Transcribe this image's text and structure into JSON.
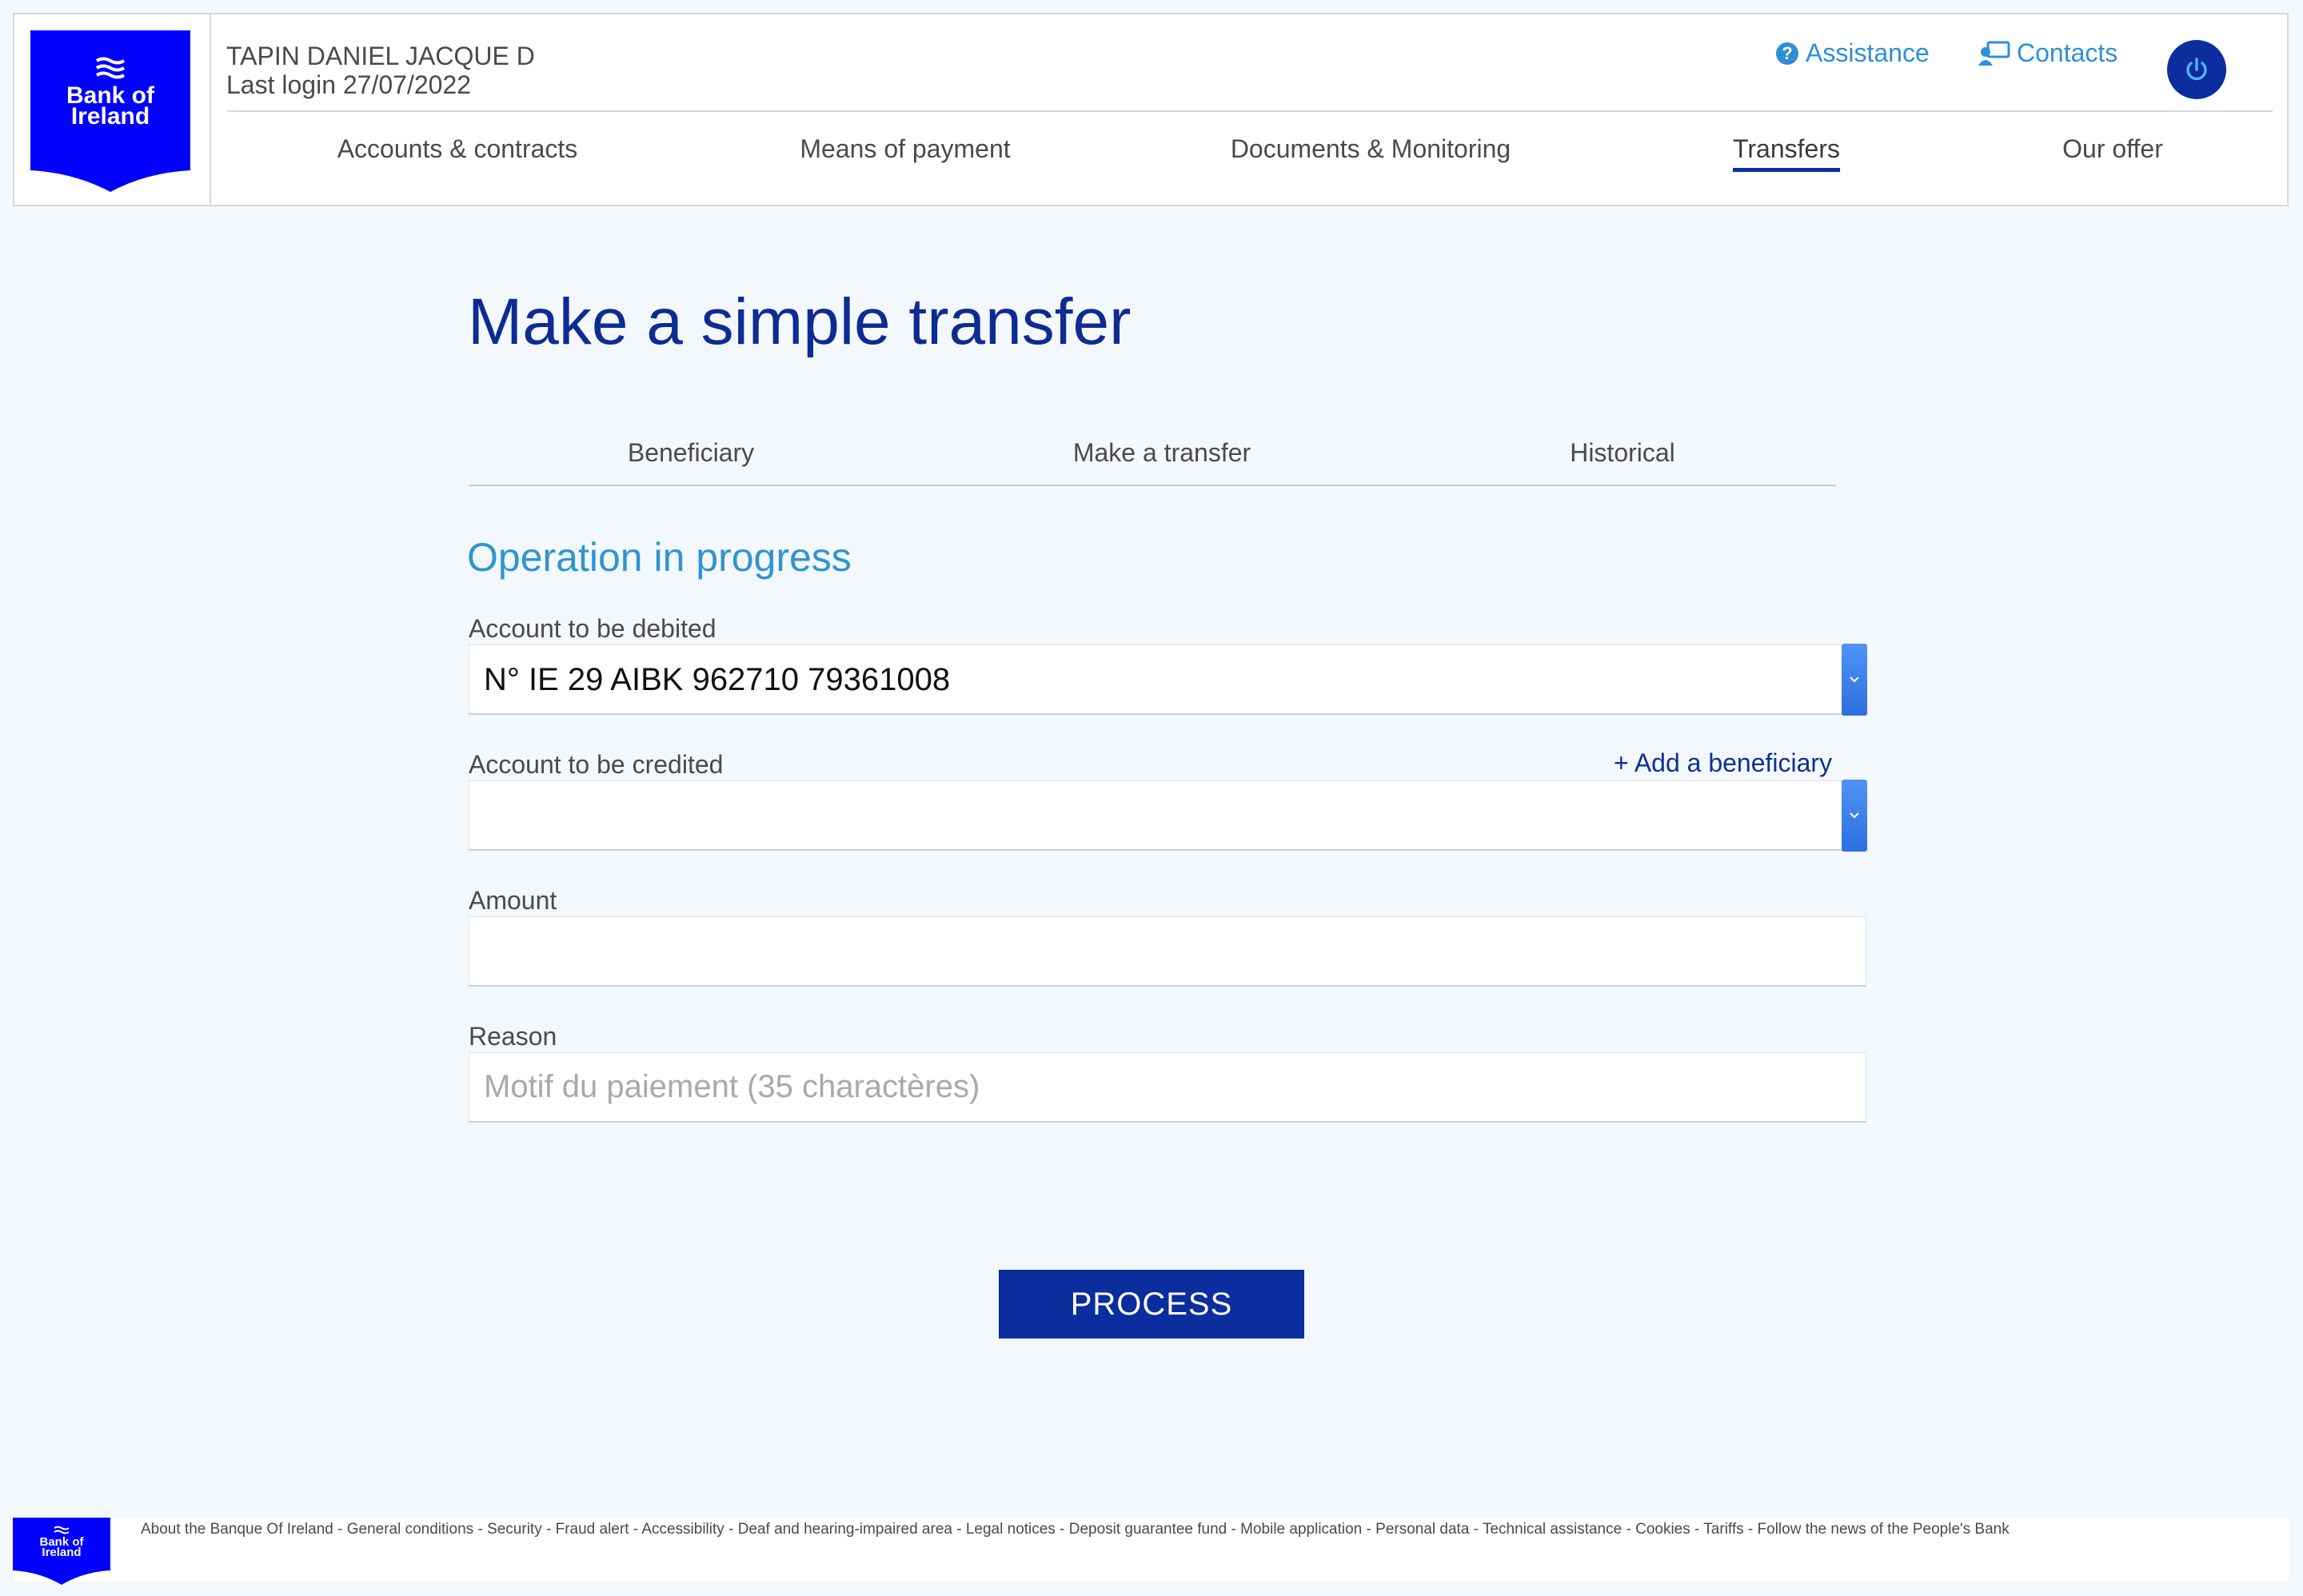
{
  "header": {
    "brand_line1": "Bank of",
    "brand_line2": "Ireland",
    "user_name": "TAPIN DANIEL JACQUE D",
    "last_login": "Last login 27/07/2022",
    "assistance_label": "Assistance",
    "contacts_label": "Contacts",
    "nav": [
      {
        "label": "Accounts & contracts"
      },
      {
        "label": "Means of payment"
      },
      {
        "label": "Documents & Monitoring"
      },
      {
        "label": "Transfers",
        "active": true
      },
      {
        "label": "Our offer"
      }
    ]
  },
  "page": {
    "title": "Make a simple transfer",
    "tabs": [
      {
        "label": "Beneficiary"
      },
      {
        "label": "Make a transfer"
      },
      {
        "label": "Historical"
      }
    ],
    "section_title": "Operation in progress"
  },
  "form": {
    "debit_label": "Account to be debited",
    "debit_value": "N° IE 29 AIBK 962710 79361008",
    "credit_label": "Account to be credited",
    "credit_value": "",
    "add_beneficiary": "+ Add a beneficiary",
    "amount_label": "Amount",
    "amount_value": "",
    "reason_label": "Reason",
    "reason_placeholder": "Motif du paiement (35 charactères)",
    "submit_label": "PROCESS"
  },
  "footer": {
    "links": [
      "About the Banque Of Ireland",
      "General conditions",
      "Security",
      "Fraud alert",
      "Accessibility",
      "Deaf and hearing-impaired area",
      "Legal notices",
      "Deposit guarantee fund",
      "Mobile application",
      "Personal data",
      "Technical assistance",
      "Cookies",
      "Tariffs",
      "Follow the news of the People's Bank"
    ]
  },
  "colors": {
    "brand_blue": "#0000ff",
    "primary_dark": "#0b2d9e",
    "accent_light": "#2f95d0",
    "page_background": "#f3f8fd"
  }
}
